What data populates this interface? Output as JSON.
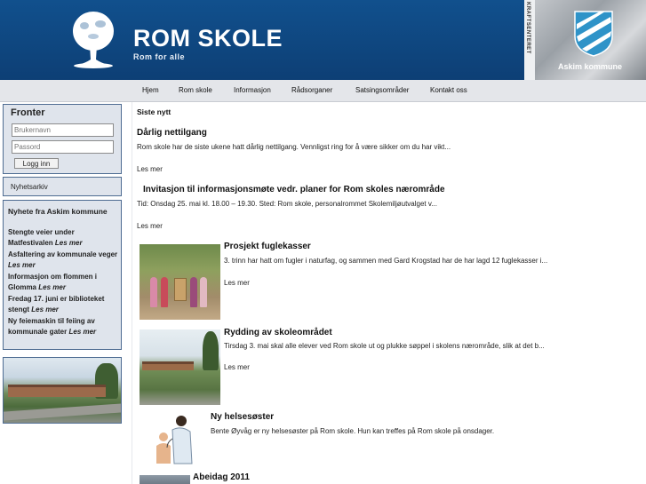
{
  "header": {
    "title": "ROM SKOLE",
    "subtitle": "Rom for alle",
    "side_strip": "KRAFTSENTERET",
    "municipality": "Askim kommune",
    "brand_color": "#11508d"
  },
  "nav": {
    "items": [
      "Hjem",
      "Rom skole",
      "Informasjon",
      "Rådsorganer",
      "Satsingsområder",
      "Kontakt oss"
    ]
  },
  "login": {
    "heading": "Fronter",
    "username_placeholder": "Brukernavn",
    "password_placeholder": "Passord",
    "button": "Logg inn"
  },
  "archive": {
    "label": "Nyhetsarkiv"
  },
  "askim_news": {
    "heading": "Nyhete fra Askim kommune",
    "items": [
      {
        "text": "Stengte veier under Matfestivalen",
        "more": "Les mer"
      },
      {
        "text": "Asfaltering av kommunale veger",
        "more": "Les mer"
      },
      {
        "text": "Informasjon om flommen i Glomma",
        "more": "Les mer"
      },
      {
        "text": "Fredag 17. juni er biblioteket stengt",
        "more": "Les mer"
      },
      {
        "text": "Ny feiemaskin til feiing av kommunale gater",
        "more": "Les mer"
      }
    ]
  },
  "main": {
    "section_title": "Siste nytt",
    "read_more": "Les mer",
    "articles": [
      {
        "title": "Dårlig nettilgang",
        "text": "Rom skole har de siste ukene hatt dårlig nettilgang. Vennligst ring for å være sikker om du har vikt..."
      },
      {
        "title": "Invitasjon til informasjonsmøte vedr. planer for Rom skoles nærområde",
        "text": "Tid:    Onsdag 25. mai kl. 18.00 – 19.30. Sted:  Rom skole, personalrommet     Skolemiljøutvalget v..."
      },
      {
        "title": "Prosjekt fuglekasser",
        "text": "3. trinn har hatt om fugler i naturfag, og sammen med Gard Krogstad har de har lagd 12 fuglekasser i..."
      },
      {
        "title": "Rydding av skoleområdet",
        "text": "Tirsdag 3. mai skal alle elever ved Rom skole ut og plukke søppel i skolens nærområde, slik at det b..."
      },
      {
        "title": "Ny helsesøster",
        "text": "Bente Øyvåg er ny helsesøster på Rom skole. Hun kan treffes på Rom skole på onsdager."
      },
      {
        "title": "Abeidag 2011",
        "text": ""
      }
    ]
  }
}
